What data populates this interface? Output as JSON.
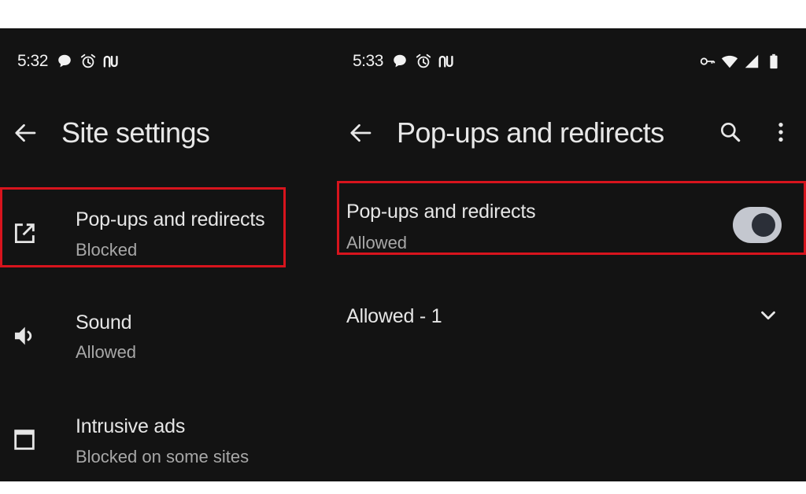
{
  "left": {
    "status": {
      "time": "5:32",
      "icons": [
        "chat-icon",
        "alarm-icon",
        "carrier-logo-icon"
      ]
    },
    "appbar": {
      "title": "Site settings",
      "back_icon": "arrow-back-icon"
    },
    "items": [
      {
        "title": "Pop-ups and redirects",
        "subtitle": "Blocked",
        "icon": "open-in-new-icon",
        "highlighted": true
      },
      {
        "title": "Sound",
        "subtitle": "Allowed",
        "icon": "volume-icon",
        "highlighted": false
      },
      {
        "title": "Intrusive ads",
        "subtitle": "Blocked on some sites",
        "icon": "window-icon",
        "highlighted": false
      }
    ]
  },
  "right": {
    "status": {
      "time": "5:33",
      "icons": [
        "chat-icon",
        "alarm-icon",
        "carrier-logo-icon"
      ],
      "right_icons": [
        "vpn-key-icon",
        "wifi-icon",
        "signal-icon",
        "battery-icon"
      ]
    },
    "appbar": {
      "title": "Pop-ups and redirects",
      "back_icon": "arrow-back-icon",
      "actions": [
        "search-icon",
        "more-vert-icon"
      ]
    },
    "setting": {
      "title": "Pop-ups and redirects",
      "subtitle": "Allowed",
      "toggle_on": true,
      "highlighted": true
    },
    "section": {
      "label": "Allowed - 1",
      "icon": "chevron-down-icon"
    }
  },
  "colors": {
    "background": "#131313",
    "text_primary": "#e6e6e6",
    "text_secondary": "#a8a8a8",
    "highlight": "#d7141d",
    "toggle_track": "#c4c7cf",
    "toggle_thumb": "#2b2f38"
  }
}
